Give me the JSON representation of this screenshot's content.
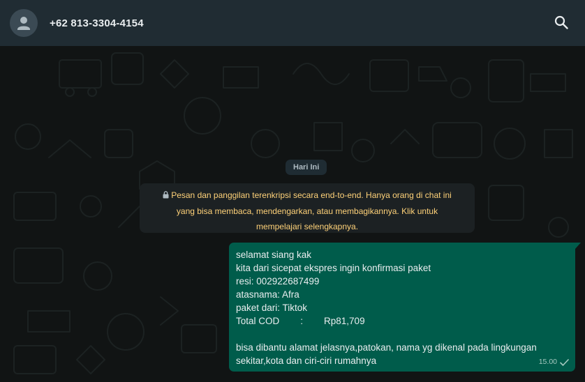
{
  "header": {
    "contact_name": "+62 813-3304-4154",
    "avatar_icon": "default-user-avatar-icon",
    "search_icon": "search-icon"
  },
  "chat": {
    "date_chip": "Hari Ini",
    "encryption_notice": {
      "icon": "lock-icon",
      "line1": "Pesan dan panggilan terenkripsi secara end-to-end. Hanya orang di chat ini",
      "line2": "yang bisa membaca, mendengarkan, atau membagikannya. Klik untuk",
      "line3": "mempelajari selengkapnya."
    },
    "messages": [
      {
        "direction": "outgoing",
        "lines": [
          "selamat siang kak",
          "kita dari sicepat ekspres ingin konfirmasi paket",
          "resi: 002922687499",
          "atasnama: Afra",
          "paket dari: Tiktok",
          "Total COD        :        Rp81,709",
          "",
          "bisa dibantu alamat jelasnya,patokan, nama yg dikenal pada lingkungan",
          "sekitar,kota dan ciri-ciri rumahnya"
        ],
        "time": "15.00",
        "status_icon": "single-check-icon"
      }
    ]
  },
  "colors": {
    "header_bg": "#202c33",
    "chat_bg": "#111414",
    "outgoing_bubble": "#005c4b",
    "notice_text": "#ffd279"
  }
}
